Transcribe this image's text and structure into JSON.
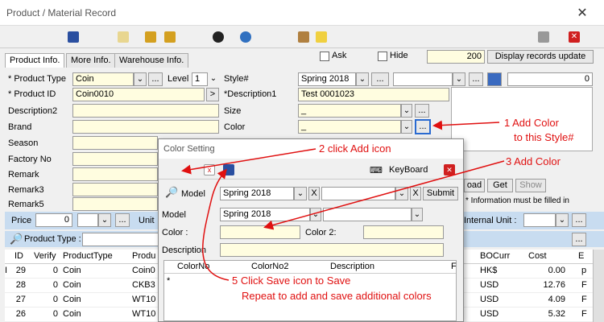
{
  "window": {
    "title": "Product / Material Record"
  },
  "tabs": [
    "Product Info.",
    "More Info.",
    "Warehouse Info."
  ],
  "top_options": {
    "ask_label": "Ask",
    "hide_label": "Hide",
    "record_count": "200",
    "display_button": "Display records update"
  },
  "form": {
    "product_type_label": "* Product Type",
    "product_type_value": "Coin",
    "level_label": "Level",
    "level_value": "1",
    "style_label": "Style#",
    "style_value": "Spring 2018",
    "style_right_value": "0",
    "product_id_label": "* Product ID",
    "product_id_value": "Coin0010",
    "description1_label": "*Description1",
    "description1_value": "Test 0001023",
    "description2_label": "Description2",
    "size_label": "Size",
    "size_value": "_",
    "brand_label": "Brand",
    "color_label": "Color",
    "color_value": "_",
    "season_label": "Season",
    "factory_label": "Factory No",
    "remark_label": "Remark",
    "remark3_label": "Remark3",
    "remark5_label": "Remark5",
    "price_label": "Price",
    "price_value": "0",
    "unit_label": "Unit",
    "internal_unit_label": "Internal Unit :",
    "load_button": "oad",
    "get_button": "Get",
    "show_button": "Show",
    "info_note": "* Information must be filled in",
    "product_type_filter_label": "Product Type :"
  },
  "grid": {
    "columns": [
      "ID",
      "Verify",
      "ProductType",
      "Produ",
      "BOCurr",
      "Cost",
      "E"
    ],
    "rows": [
      {
        "id": "29",
        "verify": "0",
        "type": "Coin",
        "prod": "Coin0",
        "curr": "HK$",
        "cost": "0.00",
        "e": "p"
      },
      {
        "id": "28",
        "verify": "0",
        "type": "Coin",
        "prod": "CKB3",
        "curr": "USD",
        "cost": "12.76",
        "e": "F"
      },
      {
        "id": "27",
        "verify": "0",
        "type": "Coin",
        "prod": "WT10",
        "curr": "USD",
        "cost": "4.09",
        "e": "F"
      },
      {
        "id": "26",
        "verify": "0",
        "type": "Coin",
        "prod": "WT10",
        "curr": "USD",
        "cost": "5.32",
        "e": "F"
      }
    ]
  },
  "dialog": {
    "title": "Color Setting",
    "keyboard_label": "KeyBoard",
    "model_label": "Model",
    "model_value": "Spring 2018",
    "x_label": "X",
    "x2_label": "X",
    "submit_label": "Submit",
    "model2_label": "Model",
    "model2_value": "Spring 2018",
    "color_label": "Color :",
    "color2_label": "Color 2:",
    "description_label": "Description",
    "sub_columns": [
      "ColorNo",
      "ColorNo2",
      "Description",
      "F"
    ],
    "new_row_marker": "*"
  },
  "annotations": {
    "step1": "1  Add Color",
    "step1b": "to this Style#",
    "step2": "2 click Add icon",
    "step3": "3 Add Color",
    "step5a": "5  Click Save icon to Save",
    "step5b": "Repeat to add and save additional colors"
  },
  "colors": {
    "annotation_red": "#e01010",
    "highlight_blue": "#c8dcf0",
    "required_yellow": "#fffde0"
  }
}
